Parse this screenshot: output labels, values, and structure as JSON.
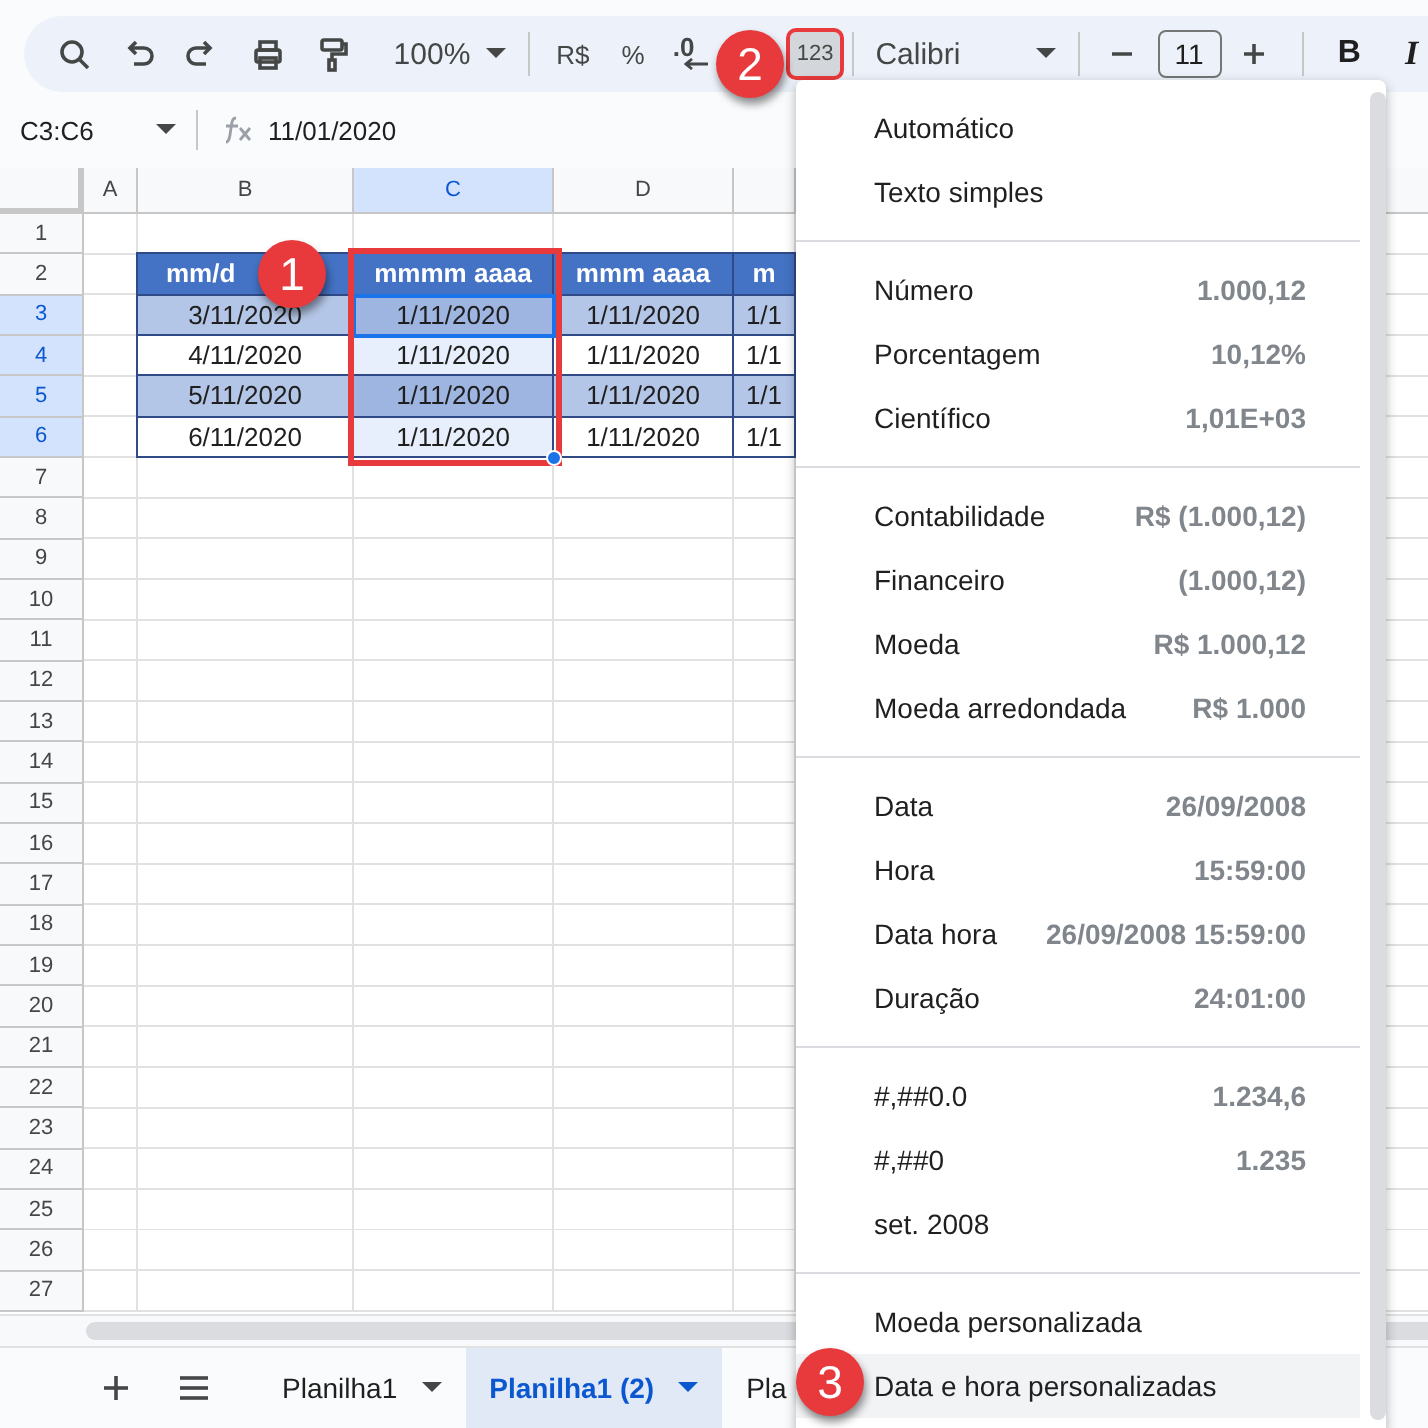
{
  "toolbar": {
    "zoom": "100%",
    "currency": "R$",
    "percent": "%",
    "decimal": ".0",
    "format": {
      "label": "123",
      "open": true,
      "outlined": true
    },
    "font": "Calibri",
    "font_size": "11",
    "bold": "B",
    "italic": "I"
  },
  "formula_bar": {
    "range": "C3:C6",
    "value": "11/01/2020"
  },
  "columns": [
    {
      "label": "A",
      "selected": false,
      "outlined": false
    },
    {
      "label": "B",
      "selected": false,
      "outlined": false
    },
    {
      "label": "C",
      "selected": true,
      "outlined": true
    },
    {
      "label": "D",
      "selected": false,
      "outlined": false
    }
  ],
  "row_numbers": [
    {
      "label": "1",
      "selected": false
    },
    {
      "label": "2",
      "selected": false
    },
    {
      "label": "3",
      "selected": true
    },
    {
      "label": "4",
      "selected": true
    },
    {
      "label": "5",
      "selected": true
    },
    {
      "label": "6",
      "selected": true
    },
    {
      "label": "7",
      "selected": false
    },
    {
      "label": "8",
      "selected": false
    },
    {
      "label": "9",
      "selected": false
    },
    {
      "label": "10",
      "selected": false
    },
    {
      "label": "11",
      "selected": false
    },
    {
      "label": "12",
      "selected": false
    },
    {
      "label": "13",
      "selected": false
    },
    {
      "label": "14",
      "selected": false
    },
    {
      "label": "15",
      "selected": false
    },
    {
      "label": "16",
      "selected": false
    },
    {
      "label": "17",
      "selected": false
    },
    {
      "label": "18",
      "selected": false
    },
    {
      "label": "19",
      "selected": false
    },
    {
      "label": "20",
      "selected": false
    },
    {
      "label": "21",
      "selected": false
    },
    {
      "label": "22",
      "selected": false
    },
    {
      "label": "23",
      "selected": false
    },
    {
      "label": "24",
      "selected": false
    },
    {
      "label": "25",
      "selected": false
    },
    {
      "label": "26",
      "selected": false
    },
    {
      "label": "27",
      "selected": false
    }
  ],
  "table": {
    "header": [
      "mm/d",
      "mmmm aaaa",
      "mmm aaaa",
      "m"
    ],
    "rows": [
      {
        "cells": [
          "3/11/2020",
          "1/11/2020",
          "1/11/2020",
          "1/1"
        ],
        "shaded": true
      },
      {
        "cells": [
          "4/11/2020",
          "1/11/2020",
          "1/11/2020",
          "1/1"
        ],
        "shaded": false
      },
      {
        "cells": [
          "5/11/2020",
          "1/11/2020",
          "1/11/2020",
          "1/1"
        ],
        "shaded": true
      },
      {
        "cells": [
          "6/11/2020",
          "1/11/2020",
          "1/11/2020",
          "1/1"
        ],
        "shaded": false
      }
    ]
  },
  "format_menu": {
    "sections": [
      [
        {
          "label": "Automático",
          "hovered": false
        },
        {
          "label": "Texto simples",
          "hovered": false
        }
      ],
      [
        {
          "label": "Número",
          "example": "1.000,12",
          "hovered": false
        },
        {
          "label": "Porcentagem",
          "example": "10,12%",
          "hovered": false
        },
        {
          "label": "Científico",
          "example": "1,01E+03",
          "hovered": false
        }
      ],
      [
        {
          "label": "Contabilidade",
          "example": "R$ (1.000,12)",
          "hovered": false
        },
        {
          "label": "Financeiro",
          "example": "(1.000,12)",
          "hovered": false
        },
        {
          "label": "Moeda",
          "example": "R$ 1.000,12",
          "hovered": false
        },
        {
          "label": "Moeda arredondada",
          "example": "R$ 1.000",
          "hovered": false
        }
      ],
      [
        {
          "label": "Data",
          "example": "26/09/2008",
          "hovered": false
        },
        {
          "label": "Hora",
          "example": "15:59:00",
          "hovered": false
        },
        {
          "label": "Data hora",
          "example": "26/09/2008 15:59:00",
          "hovered": false
        },
        {
          "label": "Duração",
          "example": "24:01:00",
          "hovered": false
        }
      ],
      [
        {
          "label": "#,##0.0",
          "example": "1.234,6",
          "hovered": false
        },
        {
          "label": "#,##0",
          "example": "1.235",
          "hovered": false
        },
        {
          "label": "set. 2008",
          "hovered": false
        }
      ],
      [
        {
          "label": "Moeda personalizada",
          "hovered": false
        },
        {
          "label": "Data e hora personalizadas",
          "hovered": true
        }
      ]
    ]
  },
  "sheet_tabs": [
    {
      "label": "Planilha1",
      "selected": false
    },
    {
      "label": "Planilha1 (2)",
      "selected": true
    },
    {
      "label": "Pla",
      "selected": false
    }
  ],
  "annotations": [
    {
      "label": "1"
    },
    {
      "label": "2"
    },
    {
      "label": "3"
    }
  ]
}
